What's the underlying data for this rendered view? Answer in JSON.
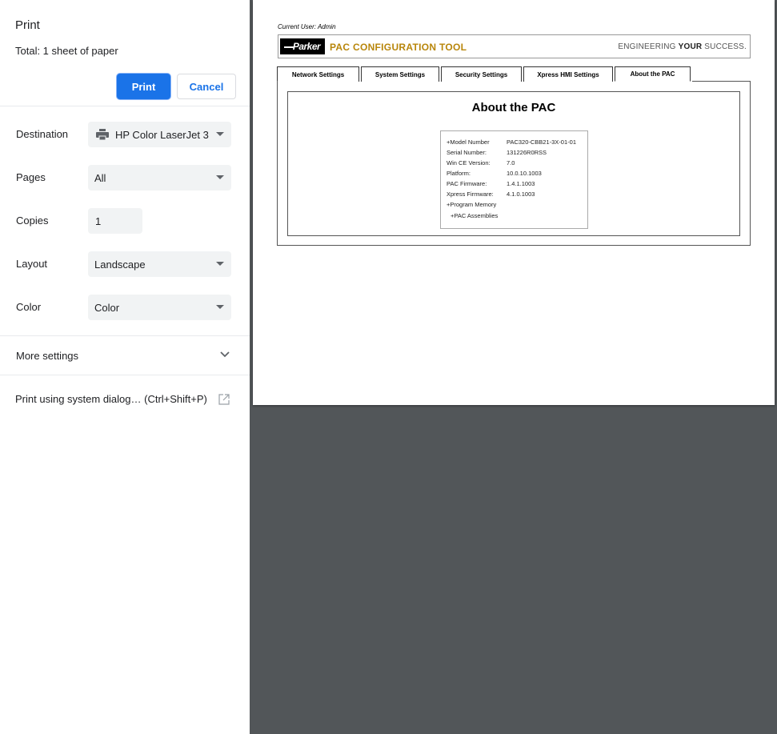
{
  "panel": {
    "title": "Print",
    "total": "Total: 1 sheet of paper",
    "print_label": "Print",
    "cancel_label": "Cancel",
    "destination": {
      "label": "Destination",
      "value": "HP Color LaserJet 3"
    },
    "pages": {
      "label": "Pages",
      "value": "All"
    },
    "copies": {
      "label": "Copies",
      "value": "1"
    },
    "layout": {
      "label": "Layout",
      "value": "Landscape"
    },
    "color": {
      "label": "Color",
      "value": "Color"
    },
    "more_settings": "More settings",
    "system_dialog": "Print using system dialog… (Ctrl+Shift+P)"
  },
  "preview": {
    "current_user": "Current User: Admin",
    "logo_text": "Parker",
    "tool_title": "PAC CONFIGURATION TOOL",
    "tagline_pre": "ENGINEERING ",
    "tagline_bold": "YOUR",
    "tagline_post": " SUCCESS.",
    "tabs": [
      {
        "label": "Network Settings"
      },
      {
        "label": "System Settings"
      },
      {
        "label": "Security Settings"
      },
      {
        "label": "Xpress HMI Settings"
      },
      {
        "label": "About the PAC"
      }
    ],
    "about_title": "About the PAC",
    "info": [
      {
        "label": "+Model Number",
        "value": "PAC320-CBB21-3X-01-01"
      },
      {
        "label": "Serial Number:",
        "value": "131226R0RSS"
      },
      {
        "label": "Win CE Version:",
        "value": "7.0"
      },
      {
        "label": "Platform:",
        "value": "10.0.10.1003"
      },
      {
        "label": "PAC Firmware:",
        "value": "1.4.1.1003"
      },
      {
        "label": "Xpress Firmware:",
        "value": "4.1.0.1003"
      },
      {
        "label": "+Program Memory",
        "value": ""
      },
      {
        "label": " +PAC Assemblies",
        "value": ""
      }
    ]
  },
  "colors": {
    "accent": "#1a73e8",
    "brand_gold": "#b8860b",
    "viewer_bg": "#525659"
  }
}
